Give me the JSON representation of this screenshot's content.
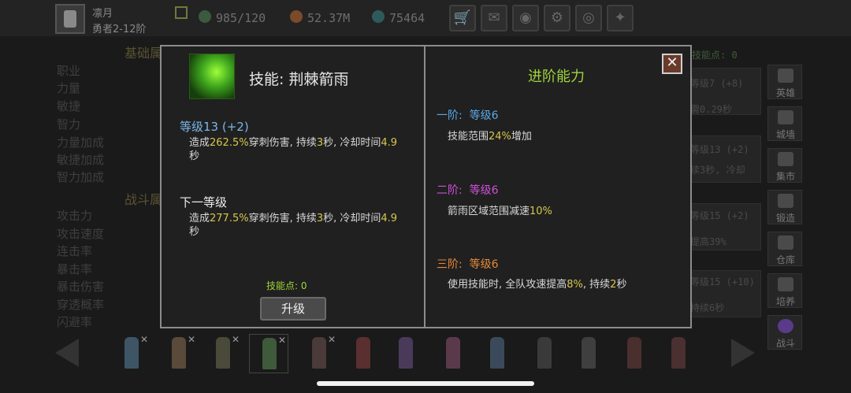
{
  "player": {
    "name": "凛月",
    "level": "勇者2-12阶"
  },
  "resources": [
    {
      "icon": "energy-icon",
      "value": "985/120"
    },
    {
      "icon": "gold-icon",
      "value": "52.37M"
    },
    {
      "icon": "gem-icon",
      "value": "75464"
    }
  ],
  "background_stats": {
    "base_section": "基础属",
    "base_labels": [
      "职业",
      "力量",
      "敏捷",
      "智力",
      "力量加成",
      "敏捷加成",
      "智力加成"
    ],
    "battle_section": "战斗属",
    "battle_labels": [
      "攻击力",
      "攻击速度",
      "连击率",
      "暴击率",
      "暴击伤害",
      "穿透概率",
      "闪避率"
    ],
    "skill_points_bg": "技能点: 0",
    "panel_texts": [
      "等级7 (+8)",
      "需0.29秒",
      "等级13 (+2)",
      "续3秒, 冷却",
      "等级15 (+2)",
      "提高39%",
      "等级15 (+10)",
      "持续6秒"
    ]
  },
  "right_nav": [
    "英雄",
    "城墙",
    "集市",
    "锻造",
    "仓库",
    "培养",
    "战斗"
  ],
  "modal": {
    "skill_title": "技能: 荆棘箭雨",
    "current_level": "等级13 (+2)",
    "current_desc_parts": [
      "造成",
      "262.5%",
      "穿刺伤害, 持续",
      "3",
      "秒, 冷却时间",
      "4.9",
      "秒"
    ],
    "next_level_title": "下一等级",
    "next_desc_parts": [
      "造成",
      "277.5%",
      "穿刺伤害, 持续",
      "3",
      "秒, 冷却时间",
      "4.9",
      "秒"
    ],
    "skill_points": "技能点: 0",
    "upgrade_label": "升级",
    "advanced_title": "进阶能力",
    "tiers": [
      {
        "name": "一阶:",
        "level": "等级6",
        "color": "#5aa8e6",
        "desc_parts": [
          "技能范围",
          "24%",
          "增加"
        ]
      },
      {
        "name": "二阶:",
        "level": "等级6",
        "color": "#d14fd8",
        "desc_parts": [
          "箭雨区域范围减速",
          "10%",
          ""
        ]
      },
      {
        "name": "三阶:",
        "level": "等级6",
        "color": "#e6893a",
        "desc_parts": [
          "使用技能时, 全队攻速提高",
          "8%",
          ", 持续",
          "2",
          "秒"
        ]
      }
    ],
    "close_label": "✕"
  },
  "colors": {
    "highlight": "#d7c64c",
    "level_blue": "#7bb7e8",
    "green": "#9fd53c"
  }
}
